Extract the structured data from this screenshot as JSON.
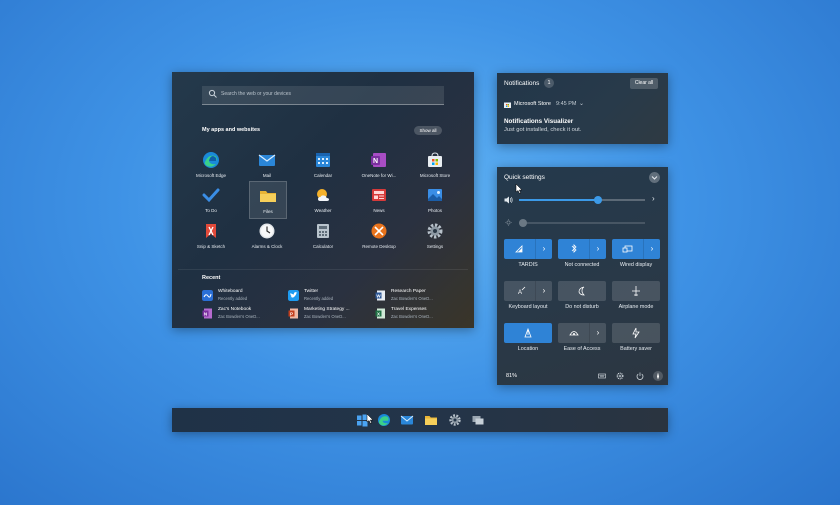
{
  "start_menu": {
    "search_placeholder": "Search the web or your devices",
    "apps_heading": "My apps and websites",
    "show_all_label": "Show all",
    "apps": [
      {
        "label": "Microsoft Edge",
        "icon": "edge-icon"
      },
      {
        "label": "Mail",
        "icon": "mail-icon"
      },
      {
        "label": "Calendar",
        "icon": "calendar-icon"
      },
      {
        "label": "OneNote for Wi...",
        "icon": "onenote-icon"
      },
      {
        "label": "Microsoft Store",
        "icon": "store-icon"
      },
      {
        "label": "To Do",
        "icon": "todo-icon"
      },
      {
        "label": "Files",
        "icon": "folder-icon"
      },
      {
        "label": "Weather",
        "icon": "weather-icon"
      },
      {
        "label": "News",
        "icon": "news-icon"
      },
      {
        "label": "Photos",
        "icon": "photos-icon"
      },
      {
        "label": "Snip & Sketch",
        "icon": "snip-icon"
      },
      {
        "label": "Alarms & Clock",
        "icon": "clock-icon"
      },
      {
        "label": "Calculator",
        "icon": "calculator-icon"
      },
      {
        "label": "Remote Desktop",
        "icon": "remote-desktop-icon"
      },
      {
        "label": "Settings",
        "icon": "settings-icon"
      }
    ],
    "recent_heading": "Recent",
    "recent": [
      {
        "title": "Whiteboard",
        "subtitle": "Recently added"
      },
      {
        "title": "Twitter",
        "subtitle": "Recently added"
      },
      {
        "title": "Research Paper",
        "subtitle": "Zac Bowden's OneD..."
      },
      {
        "title": "Zac's Notebook",
        "subtitle": "Zac Bowden's OneD..."
      },
      {
        "title": "Marketing Strategy ...",
        "subtitle": "Zac Bowden's OneD..."
      },
      {
        "title": "Travel Expenses",
        "subtitle": "Zac Bowden's OneD..."
      }
    ]
  },
  "notifications": {
    "title": "Notifications",
    "count": "1",
    "clear_all_label": "Clear all",
    "app_name": "Microsoft Store",
    "time": "9:45 PM",
    "heading": "Notifications Visualizer",
    "body": "Just got installed, check it out."
  },
  "quick_settings": {
    "title": "Quick settings",
    "volume_level": 0.63,
    "brightness_level": 0.0,
    "tiles": [
      {
        "label": "TARDIS",
        "icon": "wifi-icon",
        "on": true,
        "chevron": true
      },
      {
        "label": "Not connected",
        "icon": "bluetooth-icon",
        "on": true,
        "chevron": true
      },
      {
        "label": "Wired display",
        "icon": "display-icon",
        "on": true,
        "chevron": true
      },
      {
        "label": "Keyboard layout",
        "icon": "keyboard-layout-icon",
        "on": false,
        "chevron": true
      },
      {
        "label": "Do not disturb",
        "icon": "moon-icon",
        "on": false,
        "chevron": false
      },
      {
        "label": "Airplane mode",
        "icon": "airplane-icon",
        "on": false,
        "chevron": false
      },
      {
        "label": "Location",
        "icon": "location-icon",
        "on": true,
        "chevron": false
      },
      {
        "label": "Ease of Access",
        "icon": "ease-of-access-icon",
        "on": false,
        "chevron": true
      },
      {
        "label": "Battery saver",
        "icon": "battery-saver-icon",
        "on": false,
        "chevron": false
      }
    ],
    "battery": "81%"
  },
  "colors": {
    "accent": "#2f83d6",
    "desktop": "#3f93e6"
  }
}
